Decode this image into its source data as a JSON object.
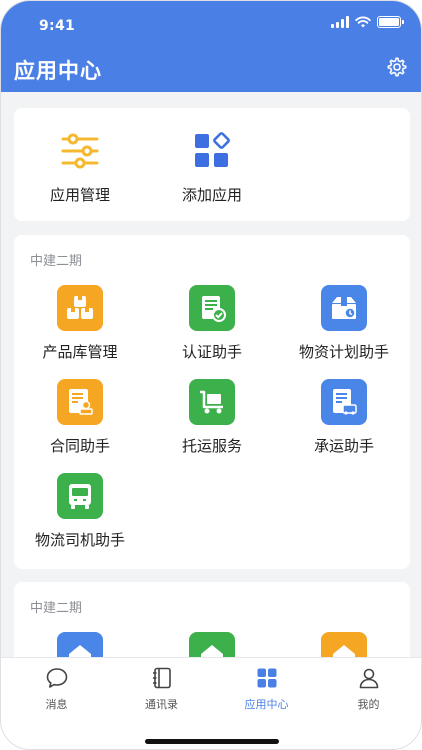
{
  "status_bar": {
    "time": "9:41"
  },
  "header": {
    "title": "应用中心",
    "settings_icon": "gear-icon"
  },
  "top_apps": [
    {
      "label": "应用管理",
      "icon": "sliders-icon",
      "color": "#f5b82e"
    },
    {
      "label": "添加应用",
      "icon": "grid-add-icon",
      "color": "#3d6fe0"
    }
  ],
  "section_1": {
    "title": "中建二期",
    "apps": [
      {
        "label": "产品库管理",
        "icon": "boxes-icon",
        "color": "#f5a623"
      },
      {
        "label": "认证助手",
        "icon": "certificate-icon",
        "color": "#3cb04a"
      },
      {
        "label": "物资计划助手",
        "icon": "box-clock-icon",
        "color": "#4a86e8"
      },
      {
        "label": "合同助手",
        "icon": "contract-stamp-icon",
        "color": "#f5a623"
      },
      {
        "label": "托运服务",
        "icon": "cart-icon",
        "color": "#3cb04a"
      },
      {
        "label": "承运助手",
        "icon": "document-truck-icon",
        "color": "#4a86e8"
      },
      {
        "label": "物流司机助手",
        "icon": "bus-icon",
        "color": "#3cb04a"
      }
    ]
  },
  "section_2": {
    "title": "中建二期",
    "apps": [
      {
        "icon": "house-icon",
        "color": "#4a86e8"
      },
      {
        "icon": "house-icon",
        "color": "#3cb04a"
      },
      {
        "icon": "house-icon",
        "color": "#f5a623"
      }
    ]
  },
  "tabbar": {
    "tabs": [
      {
        "label": "消息",
        "icon": "chat-bubble-icon"
      },
      {
        "label": "通讯录",
        "icon": "contacts-book-icon"
      },
      {
        "label": "应用中心",
        "icon": "app-grid-icon",
        "active": true
      },
      {
        "label": "我的",
        "icon": "person-icon"
      }
    ],
    "active_color": "#4a7fe6"
  },
  "colors": {
    "primary": "#4a7fe6",
    "background": "#f2f3f5"
  }
}
